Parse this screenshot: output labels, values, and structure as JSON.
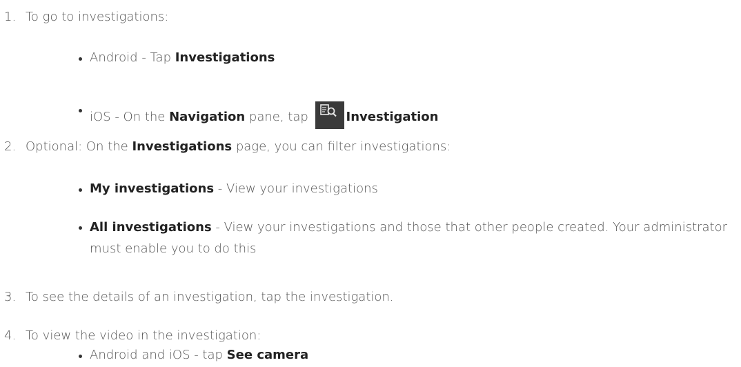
{
  "steps": [
    {
      "num": "1.",
      "text": "To go to investigations:"
    },
    {
      "num": "2.",
      "pre": "Optional: On the ",
      "bold": "Investigations",
      "post": " page, you can filter investigations:"
    },
    {
      "num": "3.",
      "text": "To see the details of an investigation, tap the investigation."
    },
    {
      "num": "4.",
      "text": "To view the video in the investigation:"
    }
  ],
  "bullets": {
    "android": {
      "pre": "Android - Tap ",
      "bold": "Investigations"
    },
    "ios": {
      "pre": "iOS - On the ",
      "bold1": "Navigation",
      "mid": " pane, tap ",
      "bold2": "Investigation",
      "icon": "investigation-search-icon"
    },
    "my": {
      "bold": "My investigations",
      "post": " - View your investigations"
    },
    "all": {
      "bold": "All investigations",
      "post": " - View your investigations and those that other people created. Your administrator must enable you to do this"
    },
    "camera": {
      "pre": "Android and iOS - tap ",
      "bold": "See camera"
    }
  },
  "colors": {
    "text": "#555555",
    "bold_text": "#222222",
    "icon_bg": "#3a3a3a"
  }
}
